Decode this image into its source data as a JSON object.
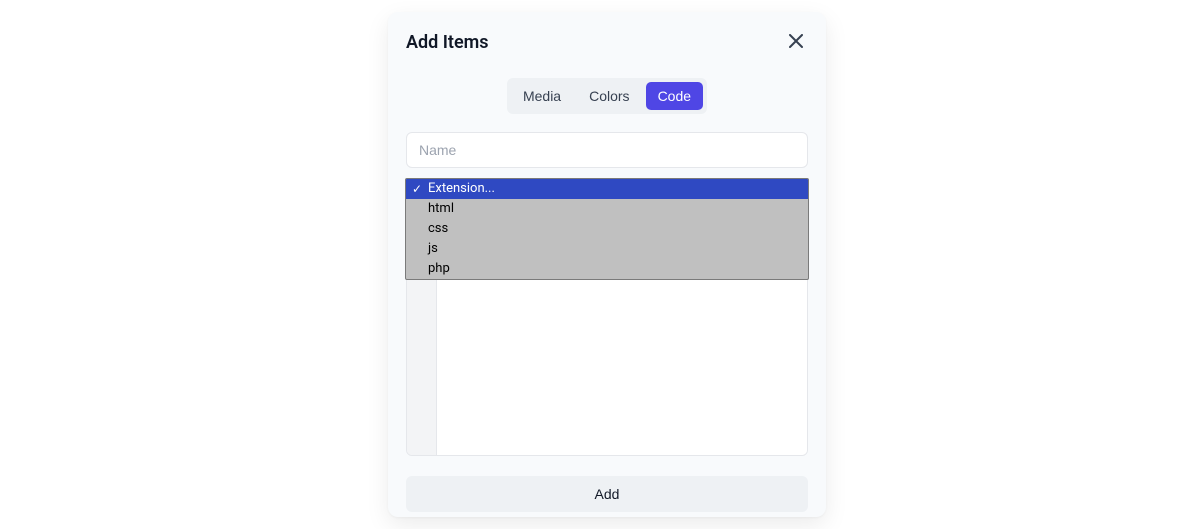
{
  "modal": {
    "title": "Add Items"
  },
  "tabs": {
    "items": [
      {
        "label": "Media",
        "active": false
      },
      {
        "label": "Colors",
        "active": false
      },
      {
        "label": "Code",
        "active": true
      }
    ]
  },
  "form": {
    "name_placeholder": "Name",
    "name_value": "",
    "extension": {
      "placeholder": "Extension...",
      "selected_index": 0,
      "options": [
        {
          "label": "Extension..."
        },
        {
          "label": "html"
        },
        {
          "label": "css"
        },
        {
          "label": "js"
        },
        {
          "label": "php"
        }
      ]
    }
  },
  "footer": {
    "add_label": "Add"
  },
  "colors": {
    "accent": "#4f46e5",
    "dropdown_highlight": "#2f49c2",
    "dropdown_bg": "#c0c0c0"
  }
}
